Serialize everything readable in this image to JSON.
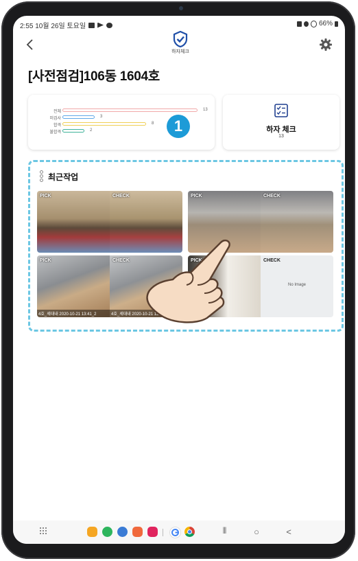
{
  "status_bar": {
    "time_date": "2:55  10월 26일 토요일",
    "battery": "66%"
  },
  "app": {
    "logo_text": "하자체크",
    "page_title": "[사전점검]106동 1604호"
  },
  "stats": [
    {
      "label": "전체",
      "value": 13,
      "color": "#f1a9a9"
    },
    {
      "label": "미검사",
      "value": 3,
      "color": "#5fa8e8"
    },
    {
      "label": "합격",
      "value": 8,
      "color": "#f0cf55"
    },
    {
      "label": "불합격",
      "value": 2,
      "color": "#3fb39a"
    }
  ],
  "stats_max": 13,
  "badge": "1",
  "check_card": {
    "title": "하자 체크",
    "count": "13"
  },
  "recent": {
    "title": "최근작업",
    "tiles": [
      {
        "left": {
          "tag": "PICK",
          "caption": ""
        },
        "right": {
          "tag": "CHECK",
          "caption": ""
        }
      },
      {
        "left": {
          "tag": "PICK",
          "caption": ""
        },
        "right": {
          "tag": "CHECK",
          "caption": ""
        }
      },
      {
        "left": {
          "tag": "PICK",
          "caption": "4호_세대내 2020-10-21 13:41_2"
        },
        "right": {
          "tag": "CHECK",
          "caption": "4호_세대내 2020-10-21 13:41_2"
        }
      },
      {
        "left": {
          "tag": "PICK",
          "caption": ""
        },
        "right": {
          "tag": "CHECK",
          "caption": "",
          "no_image": "No Image"
        }
      }
    ]
  },
  "nav": {
    "recents": "|||",
    "home": "○",
    "back": "<"
  },
  "colors": {
    "accent": "#1d9bd7",
    "dashed_border": "#6cc7e3"
  }
}
